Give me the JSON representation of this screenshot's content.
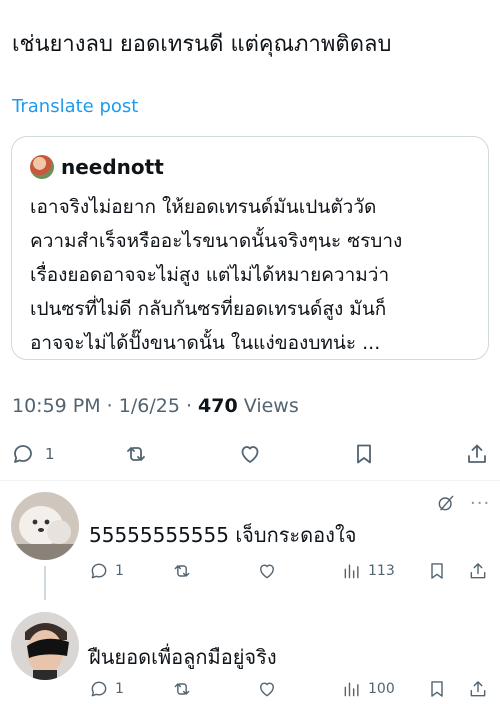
{
  "post": {
    "text": "เช่นยางลบ ยอดเทรนดี แต่คุณภาพติดลบ",
    "translate_label": "Translate post",
    "timestamp": "10:59 PM · 1/6/25 · ",
    "views_count": "470",
    "views_label": " Views",
    "reply_count": "1"
  },
  "quote": {
    "author": "neednott",
    "lines": [
      "เอาจริงไม่อยาก ให้ยอดเทรนด์มันเปนตัววัด",
      "ความสำเร็จหรืออะไรขนาดนั้นจริงๆนะ ซรบาง",
      "เรื่องยอดอาจจะไม่สูง แต่ไม่ได้หมายความว่า",
      "เปนซรที่ไม่ดี กลับกันซรที่ยอดเทรนด์สูง มันก็",
      "อาจจะไม่ได้ปั๊งขนาดนั้น ในแง่ของบทน่ะ ..."
    ]
  },
  "replies": [
    {
      "text": "55555555555 เจ็บกระดองใจ",
      "reply_count": "1",
      "views": "113"
    },
    {
      "text": "ฝืนยอดเพื่อลูกมือยู่จริง",
      "reply_count": "1",
      "views": "100"
    }
  ],
  "more_label": "···",
  "icons": {
    "reply": "reply-icon",
    "repost": "repost-icon",
    "like": "heart-icon",
    "bookmark": "bookmark-icon",
    "share": "share-icon",
    "views": "views-icon",
    "grok": "grok-icon"
  },
  "colors": {
    "link": "#1d9bf0",
    "muted": "#536471",
    "border": "#cfd9de"
  }
}
